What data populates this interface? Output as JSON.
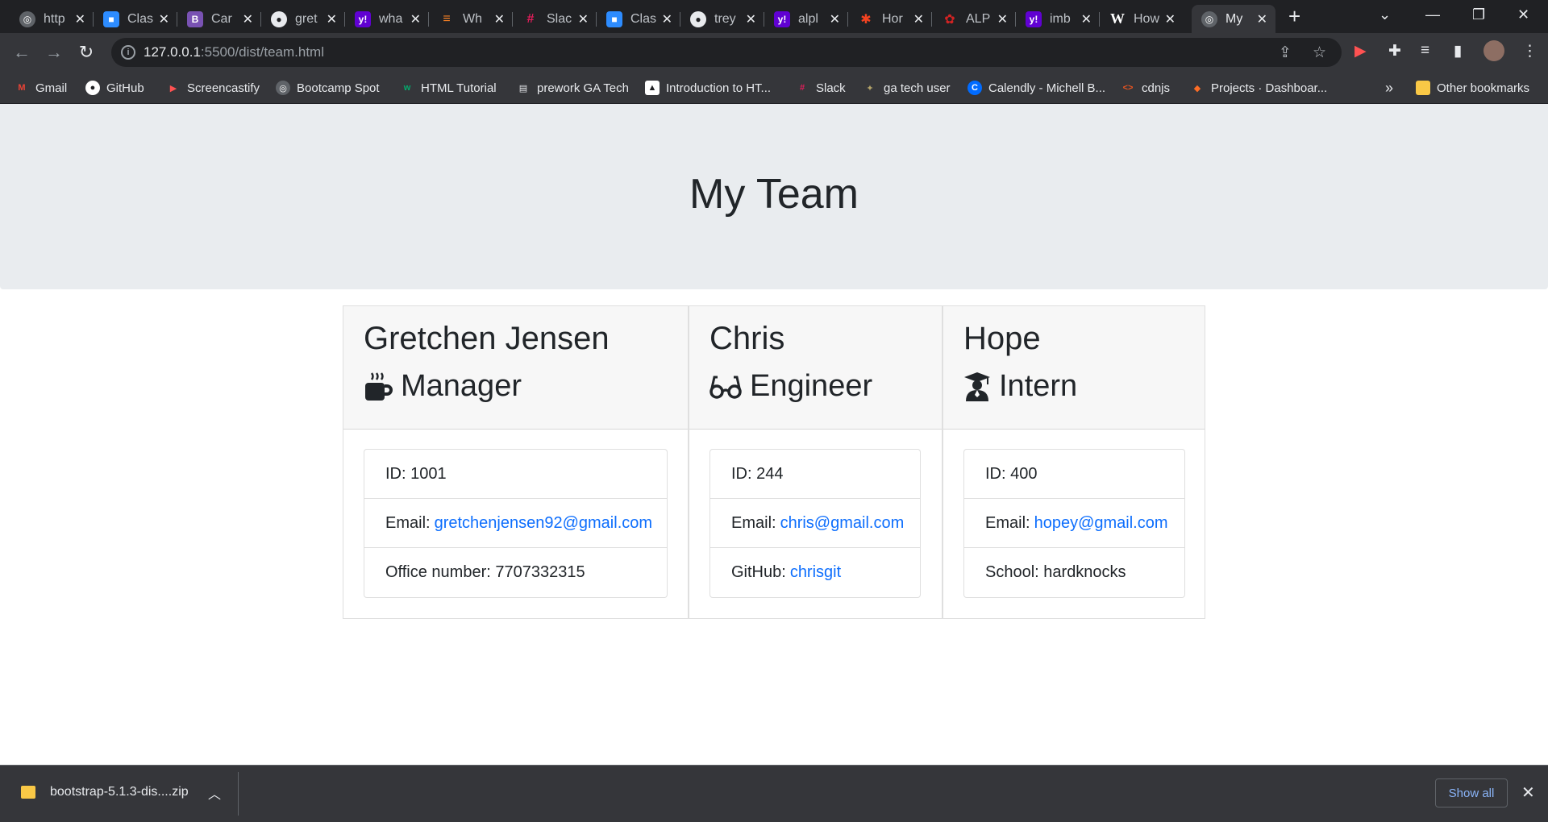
{
  "browser": {
    "tabs": [
      {
        "title": "http",
        "icon": "globe-icon",
        "color": "#5f6368"
      },
      {
        "title": "Clas",
        "icon": "zoom-icon",
        "color": "#2d8cff"
      },
      {
        "title": "Car",
        "icon": "bootstrap-icon",
        "color": "#7952b3"
      },
      {
        "title": "gret",
        "icon": "github-icon",
        "color": "#24292f"
      },
      {
        "title": "wha",
        "icon": "yahoo-icon",
        "color": "#6001d2"
      },
      {
        "title": "Wh",
        "icon": "stackoverflow-icon",
        "color": "#f48024"
      },
      {
        "title": "Slac",
        "icon": "slack-icon",
        "color": "#e01e5a"
      },
      {
        "title": "Clas",
        "icon": "zoom-icon",
        "color": "#2d8cff"
      },
      {
        "title": "trey",
        "icon": "github-icon",
        "color": "#24292f"
      },
      {
        "title": "alpl",
        "icon": "yahoo-icon",
        "color": "#6001d2"
      },
      {
        "title": "Hor",
        "icon": "joomla-icon",
        "color": "#f44321"
      },
      {
        "title": "ALP",
        "icon": "yelp-icon",
        "color": "#d32323"
      },
      {
        "title": "imb",
        "icon": "yahoo-icon",
        "color": "#6001d2"
      },
      {
        "title": "How",
        "icon": "wikipedia-icon",
        "color": "#ffffff"
      },
      {
        "title": "My",
        "icon": "globe-icon",
        "color": "#5f6368",
        "active": true
      }
    ],
    "url_host": "127.0.0.1",
    "url_rest": ":5500/dist/team.html",
    "bookmarks": [
      {
        "label": "Gmail",
        "icon": "gmail-icon",
        "color": "#ea4335"
      },
      {
        "label": "GitHub",
        "icon": "github-icon",
        "color": "#ffffff"
      },
      {
        "label": "Screencastify",
        "icon": "screencastify-icon",
        "color": "#ff5252"
      },
      {
        "label": "Bootcamp Spot",
        "icon": "globe-icon",
        "color": "#9aa0a6"
      },
      {
        "label": "HTML Tutorial",
        "icon": "w3schools-icon",
        "color": "#04aa6d"
      },
      {
        "label": "prework GA Tech",
        "icon": "book-icon",
        "color": "#e8eaed"
      },
      {
        "label": "Introduction to HT...",
        "icon": "cap-icon",
        "color": "#ffffff"
      },
      {
        "label": "Slack",
        "icon": "slack-icon",
        "color": "#e01e5a"
      },
      {
        "label": "ga tech user",
        "icon": "gatech-icon",
        "color": "#b3a369"
      },
      {
        "label": "Calendly - Michell B...",
        "icon": "calendly-icon",
        "color": "#006bff"
      },
      {
        "label": "cdnjs",
        "icon": "code-icon",
        "color": "#e95420"
      },
      {
        "label": "Projects · Dashboar...",
        "icon": "gitlab-icon",
        "color": "#fc6d26"
      }
    ],
    "bookmarks_more": "»",
    "other_bookmarks": "Other bookmarks"
  },
  "page": {
    "title": "My Team",
    "team": [
      {
        "name": "Gretchen Jensen",
        "role": "Manager",
        "role_icon": "coffee-mug-icon",
        "id_label": "ID:",
        "id": "1001",
        "email_label": "Email:",
        "email": "gretchenjensen92@gmail.com",
        "extra_label": "Office number:",
        "extra_value": "7707332315"
      },
      {
        "name": "Chris",
        "role": "Engineer",
        "role_icon": "glasses-icon",
        "id_label": "ID:",
        "id": "244",
        "email_label": "Email:",
        "email": "chris@gmail.com",
        "extra_label": "GitHub:",
        "extra_value": "chrisgit"
      },
      {
        "name": "Hope",
        "role": "Intern",
        "role_icon": "graduate-icon",
        "id_label": "ID:",
        "id": "400",
        "email_label": "Email:",
        "email": "hopey@gmail.com",
        "extra_label": "School:",
        "extra_value": "hardknocks"
      }
    ],
    "colors": {
      "jumbotron": "#e9ecef",
      "link": "#0d6efd",
      "card_header": "#f7f7f7"
    }
  },
  "downloads": {
    "file": "bootstrap-5.1.3-dis....zip",
    "show_all": "Show all"
  }
}
